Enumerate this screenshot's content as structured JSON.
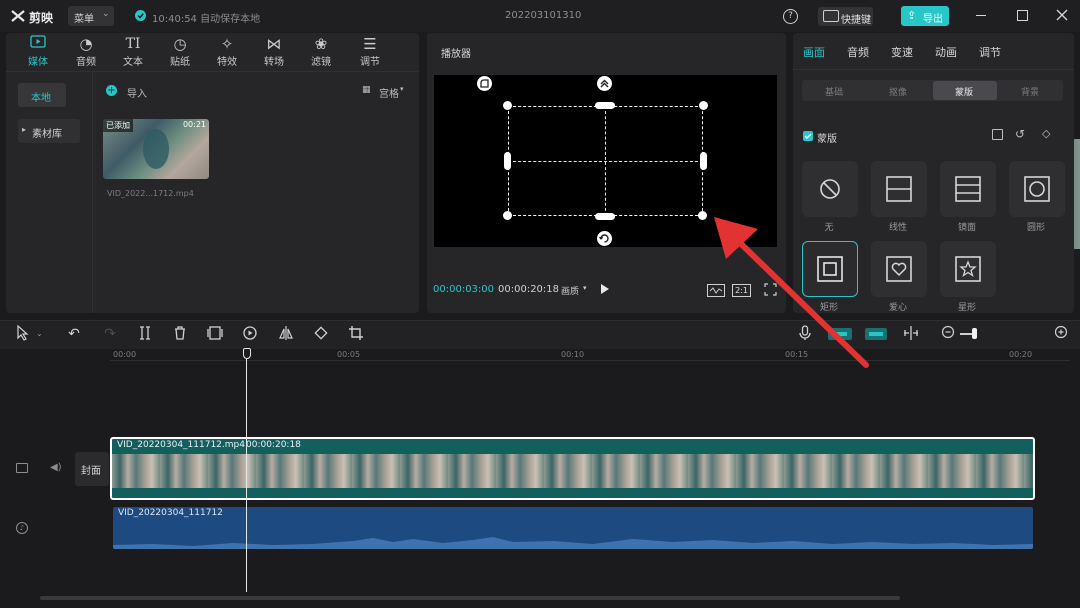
{
  "titlebar": {
    "app_name": "剪映",
    "menu_label": "菜单",
    "save_status": "10:40:54 自动保存本地",
    "project_name": "202203101310",
    "shortcut_label": "快捷键",
    "export_label": "导出"
  },
  "media_panel": {
    "tabs": [
      {
        "label": "媒体",
        "icon": "media-icon"
      },
      {
        "label": "音频",
        "icon": "audio-icon"
      },
      {
        "label": "文本",
        "icon": "text-icon"
      },
      {
        "label": "贴纸",
        "icon": "sticker-icon"
      },
      {
        "label": "特效",
        "icon": "effects-icon"
      },
      {
        "label": "转场",
        "icon": "transition-icon"
      },
      {
        "label": "滤镜",
        "icon": "filter-icon"
      },
      {
        "label": "调节",
        "icon": "adjust-icon"
      }
    ],
    "side": {
      "local": "本地",
      "library": "素材库"
    },
    "import_label": "导入",
    "view_label": "宫格",
    "clip": {
      "badge": "已添加",
      "duration": "00:21",
      "name": "VID_2022...1712.mp4"
    }
  },
  "player": {
    "title": "播放器",
    "current_time": "00:00:03:00",
    "total_time": "00:00:20:18",
    "ratio_menu": "画质",
    "aspect": "2:1"
  },
  "inspector": {
    "tabs": [
      "画面",
      "音频",
      "变速",
      "动画",
      "调节"
    ],
    "subtabs": [
      "基础",
      "抠像",
      "蒙版",
      "背景"
    ],
    "mask_toggle_label": "蒙版",
    "masks": [
      {
        "label": "无",
        "icon": "none-icon"
      },
      {
        "label": "线性",
        "icon": "linear-icon"
      },
      {
        "label": "镜面",
        "icon": "mirror-icon"
      },
      {
        "label": "圆形",
        "icon": "circle-icon"
      },
      {
        "label": "矩形",
        "icon": "rectangle-icon"
      },
      {
        "label": "爱心",
        "icon": "heart-icon"
      },
      {
        "label": "星形",
        "icon": "star-icon"
      }
    ]
  },
  "timeline": {
    "ticks": [
      "00:00",
      "00:05",
      "00:10",
      "00:15",
      "00:20"
    ],
    "cover_label": "封面",
    "video_clip_label": "VID_20220304_111712.mp4",
    "video_clip_duration": "00:00:20:18",
    "audio_clip_label": "VID_20220304_111712"
  },
  "colors": {
    "accent": "#29c6c9",
    "arrow": "#e23232",
    "video_track": "#135f5e",
    "audio_track": "#1d4a80"
  }
}
